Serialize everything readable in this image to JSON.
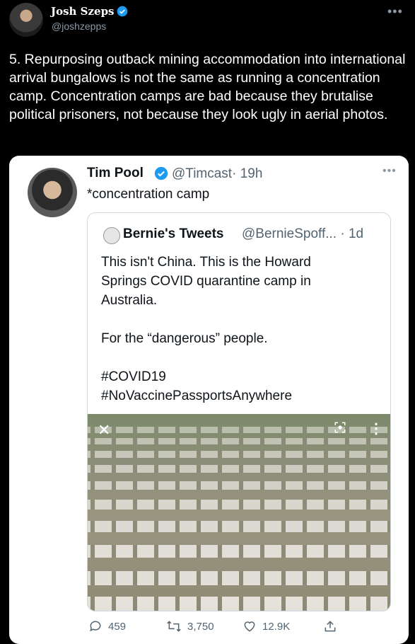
{
  "outer_tweet": {
    "author_name": "Josh Szeps",
    "author_handle": "@joshzepps",
    "text": "5. Repurposing outback mining accommodation into international arrival bungalows is not the same as running a concentration camp. Concentration camps are bad because they brutalise political prisoners, not because they look ugly in aerial photos."
  },
  "embedded_tweet": {
    "author_name": "Tim Pool",
    "author_handle": "@Timcast",
    "time": "· 19h",
    "text": "*concentration camp",
    "quote": {
      "author_name": "Bernie's Tweets",
      "author_handle": "@BernieSpoff... · 1d",
      "text": "This isn't China. This is the Howard\nSprings COVID quarantine camp in\nAustralia.\n\nFor the “dangerous” people.\n\n#COVID19\n#NoVaccinePassportsAnywhere"
    },
    "stats": {
      "replies": "459",
      "retweets": "3,750",
      "likes": "12.9K"
    }
  },
  "icons": [
    "verified-badge-icon",
    "more-options-icon",
    "close-icon",
    "lens-icon",
    "kebab-menu-icon",
    "reply-icon",
    "retweet-icon",
    "like-icon",
    "share-icon"
  ],
  "colors": {
    "background": "#000000",
    "verified": "#1d9bf0",
    "secondary_text": "#536471",
    "card_border": "#cfd9de"
  }
}
